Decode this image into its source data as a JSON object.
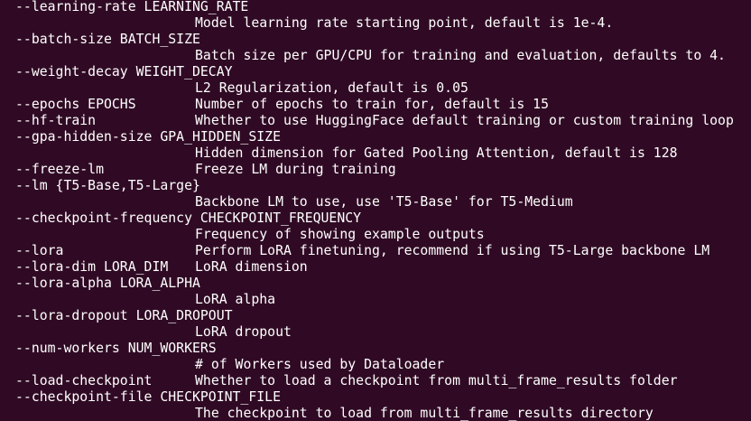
{
  "colors": {
    "background": "#300a24",
    "text": "#ffffff"
  },
  "lines": [
    {
      "opt": "--learning-rate LEARNING_RATE",
      "desc": ""
    },
    {
      "opt": "",
      "desc": "Model learning rate starting point, default is 1e-4."
    },
    {
      "opt": "--batch-size BATCH_SIZE",
      "desc": ""
    },
    {
      "opt": "",
      "desc": "Batch size per GPU/CPU for training and evaluation, defaults to 4."
    },
    {
      "opt": "--weight-decay WEIGHT_DECAY",
      "desc": ""
    },
    {
      "opt": "",
      "desc": "L2 Regularization, default is 0.05"
    },
    {
      "opt": "--epochs EPOCHS",
      "desc": "Number of epochs to train for, default is 15"
    },
    {
      "opt": "--hf-train",
      "desc": "Whether to use HuggingFace default training or custom training loop"
    },
    {
      "opt": "--gpa-hidden-size GPA_HIDDEN_SIZE",
      "desc": ""
    },
    {
      "opt": "",
      "desc": "Hidden dimension for Gated Pooling Attention, default is 128"
    },
    {
      "opt": "--freeze-lm",
      "desc": "Freeze LM during training"
    },
    {
      "opt": "--lm {T5-Base,T5-Large}",
      "desc": ""
    },
    {
      "opt": "",
      "desc": "Backbone LM to use, use 'T5-Base' for T5-Medium"
    },
    {
      "opt": "--checkpoint-frequency CHECKPOINT_FREQUENCY",
      "desc": ""
    },
    {
      "opt": "",
      "desc": "Frequency of showing example outputs"
    },
    {
      "opt": "--lora",
      "desc": "Perform LoRA finetuning, recommend if using T5-Large backbone LM"
    },
    {
      "opt": "--lora-dim LORA_DIM",
      "desc": "LoRA dimension"
    },
    {
      "opt": "--lora-alpha LORA_ALPHA",
      "desc": ""
    },
    {
      "opt": "",
      "desc": "LoRA alpha"
    },
    {
      "opt": "--lora-dropout LORA_DROPOUT",
      "desc": ""
    },
    {
      "opt": "",
      "desc": "LoRA dropout"
    },
    {
      "opt": "--num-workers NUM_WORKERS",
      "desc": ""
    },
    {
      "opt": "",
      "desc": "# of Workers used by Dataloader"
    },
    {
      "opt": "--load-checkpoint",
      "desc": "Whether to load a checkpoint from multi_frame_results folder"
    },
    {
      "opt": "--checkpoint-file CHECKPOINT_FILE",
      "desc": ""
    },
    {
      "opt": "",
      "desc": "The checkpoint to load from multi_frame_results directory"
    }
  ]
}
